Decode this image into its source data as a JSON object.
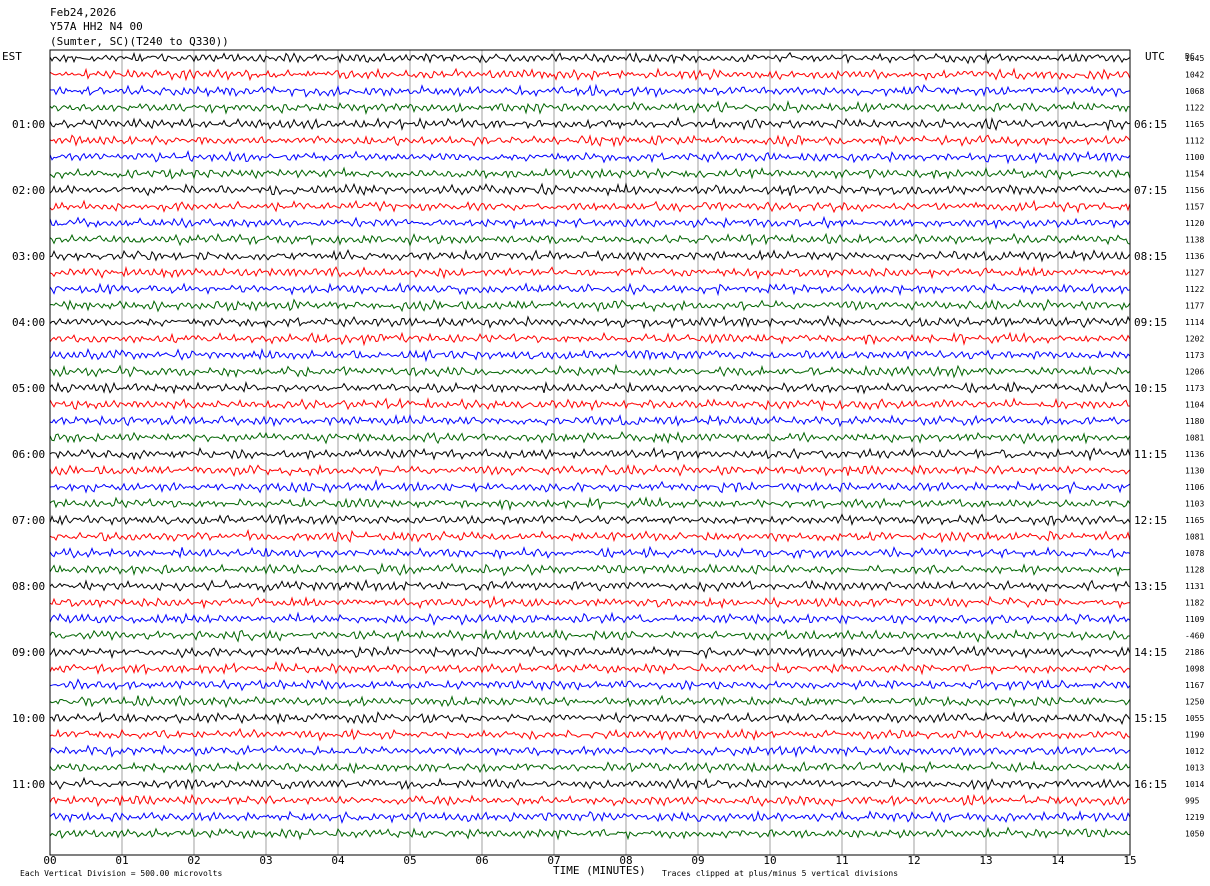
{
  "header": {
    "date": "Feb24,2026",
    "station": "Y57A HH2 N4 00",
    "location": "(Sumter, SC)(T240 to Q330))"
  },
  "axis_labels": {
    "left": "EST",
    "right": "UTC",
    "far_right": "DC",
    "bottom": "TIME (MINUTES)"
  },
  "footer": {
    "scale_note": "Each Vertical Division =  500.00 microvolts",
    "clip_note": "Traces clipped at plus/minus 5 vertical divisions"
  },
  "chart_data": {
    "type": "line",
    "x_ticks": [
      "00",
      "01",
      "02",
      "03",
      "04",
      "05",
      "06",
      "07",
      "08",
      "09",
      "10",
      "11",
      "12",
      "13",
      "14",
      "15"
    ],
    "x_range_minutes": [
      0,
      15
    ],
    "grid": "vertical-lines-every-minute",
    "trace_colors": [
      "#000000",
      "#ff0000",
      "#0000ff",
      "#006400"
    ],
    "est_hour_labels": [
      "01:00",
      "02:00",
      "03:00",
      "04:00",
      "05:00",
      "06:00",
      "07:00",
      "08:00",
      "09:00",
      "10:00",
      "11:00"
    ],
    "utc_hour_labels": [
      "06:15",
      "07:15",
      "08:15",
      "09:15",
      "10:15",
      "11:15",
      "12:15",
      "13:15",
      "14:15",
      "15:15",
      "16:15"
    ],
    "trace_dc_offsets": [
      "1045",
      "1042",
      "1068",
      "1122",
      "1165",
      "1112",
      "1100",
      "1154",
      "1156",
      "1157",
      "1120",
      "1138",
      "1136",
      "1127",
      "1122",
      "1177",
      "1114",
      "1202",
      "1173",
      "1206",
      "1173",
      "1104",
      "1180",
      "1081",
      "1136",
      "1130",
      "1106",
      "1103",
      "1165",
      "1081",
      "1078",
      "1128",
      "1131",
      "1182",
      "1109",
      "-460",
      "2186",
      "1098",
      "1167",
      "1250",
      "1055",
      "1190",
      "1012",
      "1013",
      "1014",
      "995",
      "1219",
      "1050"
    ]
  }
}
